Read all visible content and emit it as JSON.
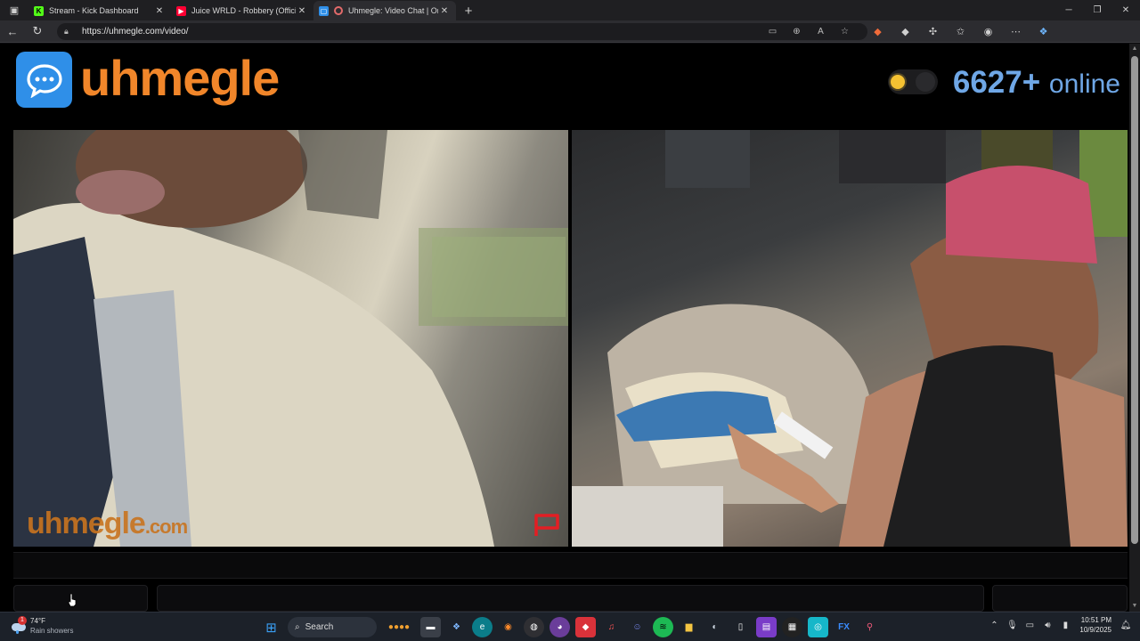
{
  "browser": {
    "tabs": [
      {
        "title": "Stream - Kick Dashboard",
        "favicon": "kick",
        "color": "#53fc18",
        "active": false
      },
      {
        "title": "Juice WRLD - Robbery (Official M",
        "favicon": "youtube",
        "color": "#ff0033",
        "active": false
      },
      {
        "title": "Uhmegle: Video Chat | Ome",
        "favicon": "uhmegle",
        "color": "#2f8fe8",
        "active": true
      }
    ],
    "url": "https://uhmegle.com/video/"
  },
  "site": {
    "logo_text": "uhmegle",
    "online_count": "6627+",
    "online_label": "online",
    "watermark_main": "uhmegle",
    "watermark_suffix": ".com",
    "accent_color": "#f1862a",
    "brand_blue": "#2f8fe8"
  },
  "taskbar": {
    "weather_temp": "74°F",
    "weather_condition": "Rain showers",
    "weather_badge": "1",
    "search_placeholder": "Search",
    "time": "10:51 PM",
    "date": "10/9/2025"
  }
}
